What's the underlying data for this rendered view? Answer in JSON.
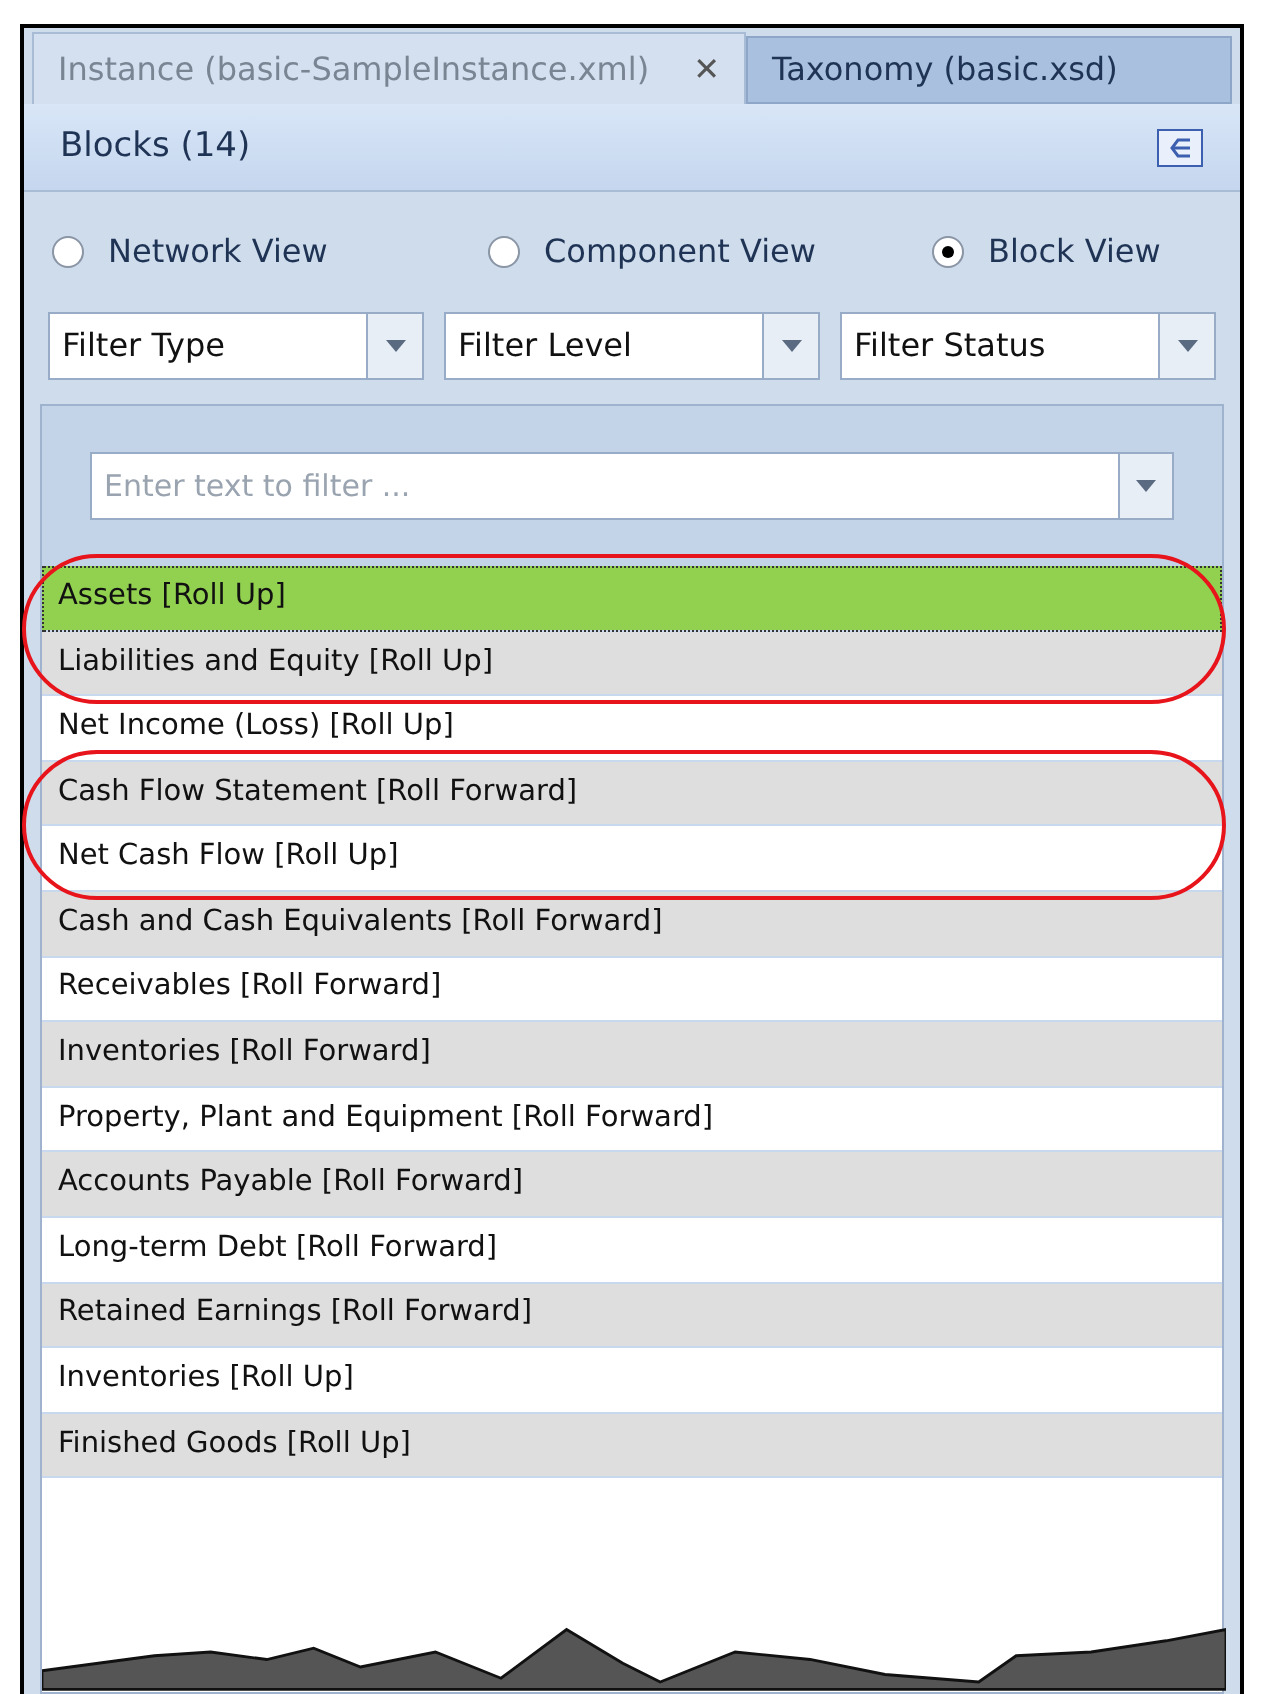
{
  "tabs": [
    {
      "label": "Instance (basic-SampleInstance.xml)",
      "selected": true,
      "close": "✕"
    },
    {
      "label": "Taxonomy (basic.xsd)",
      "selected": false
    }
  ],
  "panel": {
    "title": "Blocks (14)"
  },
  "views": [
    {
      "label": "Network View",
      "selected": false
    },
    {
      "label": "Component View",
      "selected": false
    },
    {
      "label": "Block View",
      "selected": true
    }
  ],
  "filters": [
    {
      "value": "Filter Type"
    },
    {
      "value": "Filter Level"
    },
    {
      "value": "Filter Status"
    }
  ],
  "search": {
    "placeholder": "Enter text to filter ..."
  },
  "rows": [
    {
      "label": "Assets [Roll Up]",
      "selected": true,
      "circled": true
    },
    {
      "label": "Liabilities and Equity [Roll Up]",
      "selected": false,
      "circled": true
    },
    {
      "label": "Net Income (Loss) [Roll Up]",
      "selected": false,
      "circled": false
    },
    {
      "label": "Cash Flow Statement [Roll Forward]",
      "selected": false,
      "circled": true
    },
    {
      "label": "Net Cash Flow [Roll Up]",
      "selected": false,
      "circled": true
    },
    {
      "label": "Cash and Cash Equivalents [Roll Forward]",
      "selected": false,
      "circled": false
    },
    {
      "label": "Receivables [Roll Forward]",
      "selected": false,
      "circled": false
    },
    {
      "label": "Inventories [Roll Forward]",
      "selected": false,
      "circled": false
    },
    {
      "label": "Property, Plant and Equipment [Roll Forward]",
      "selected": false,
      "circled": false
    },
    {
      "label": "Accounts Payable [Roll Forward]",
      "selected": false,
      "circled": false
    },
    {
      "label": "Long-term Debt [Roll Forward]",
      "selected": false,
      "circled": false
    },
    {
      "label": "Retained Earnings [Roll Forward]",
      "selected": false,
      "circled": false
    },
    {
      "label": "Inventories [Roll Up]",
      "selected": false,
      "circled": false
    },
    {
      "label": "Finished Goods [Roll Up]",
      "selected": false,
      "circled": false
    }
  ]
}
